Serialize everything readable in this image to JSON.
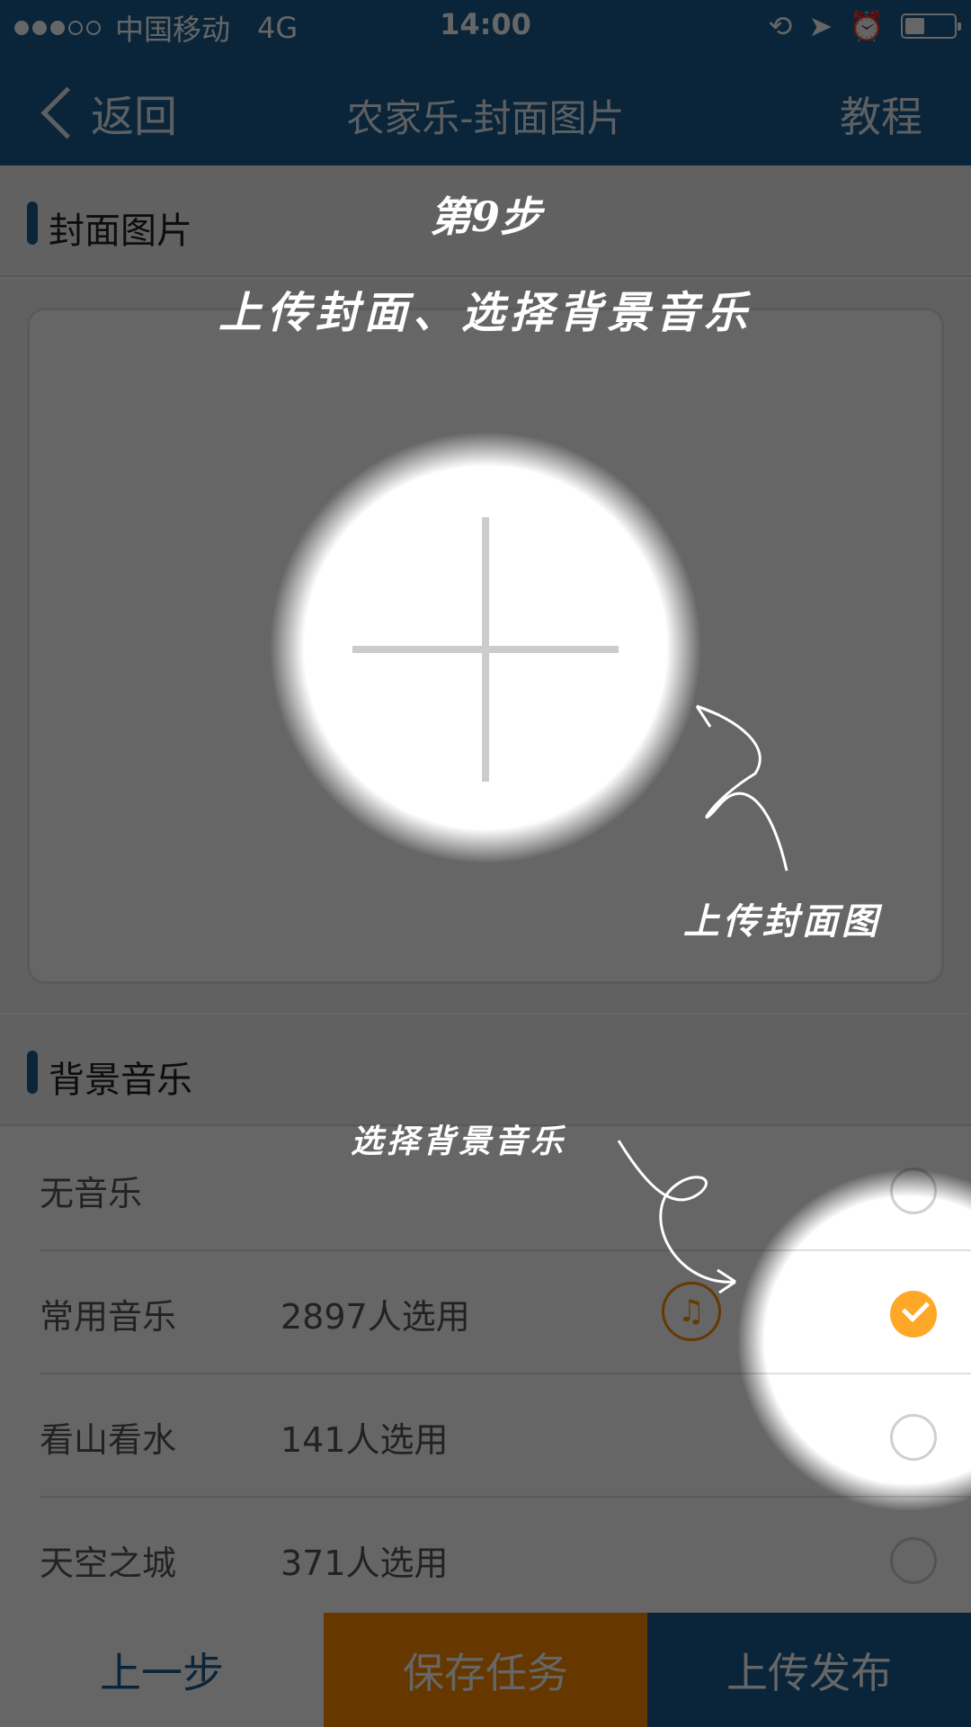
{
  "status_bar": {
    "carrier": "中国移动",
    "network": "4G",
    "time": "14:00",
    "signal_strength": 3,
    "signal_max": 5,
    "battery_level": 0.4
  },
  "nav": {
    "back_label": "返回",
    "title": "农家乐-封面图片",
    "right_label": "教程"
  },
  "cover_section": {
    "title": "封面图片"
  },
  "music_section": {
    "title": "背景音乐",
    "items": [
      {
        "name": "无音乐",
        "count": "",
        "selected": false
      },
      {
        "name": "常用音乐",
        "count": "2897人选用",
        "selected": true,
        "icon": "music-note-icon"
      },
      {
        "name": "看山看水",
        "count": "141人选用",
        "selected": false
      },
      {
        "name": "天空之城",
        "count": "371人选用",
        "selected": false
      }
    ]
  },
  "bottom_bar": {
    "prev_label": "上一步",
    "save_label": "保存任务",
    "publish_label": "上传发布"
  },
  "tutorial": {
    "step": "第9步",
    "subtitle": "上传封面、选择背景音乐",
    "cover_note": "上传封面图",
    "music_note": "选择背景音乐"
  },
  "colors": {
    "brand": "#1a5c8f",
    "accent": "#ffa726",
    "save": "#ff8c00"
  }
}
